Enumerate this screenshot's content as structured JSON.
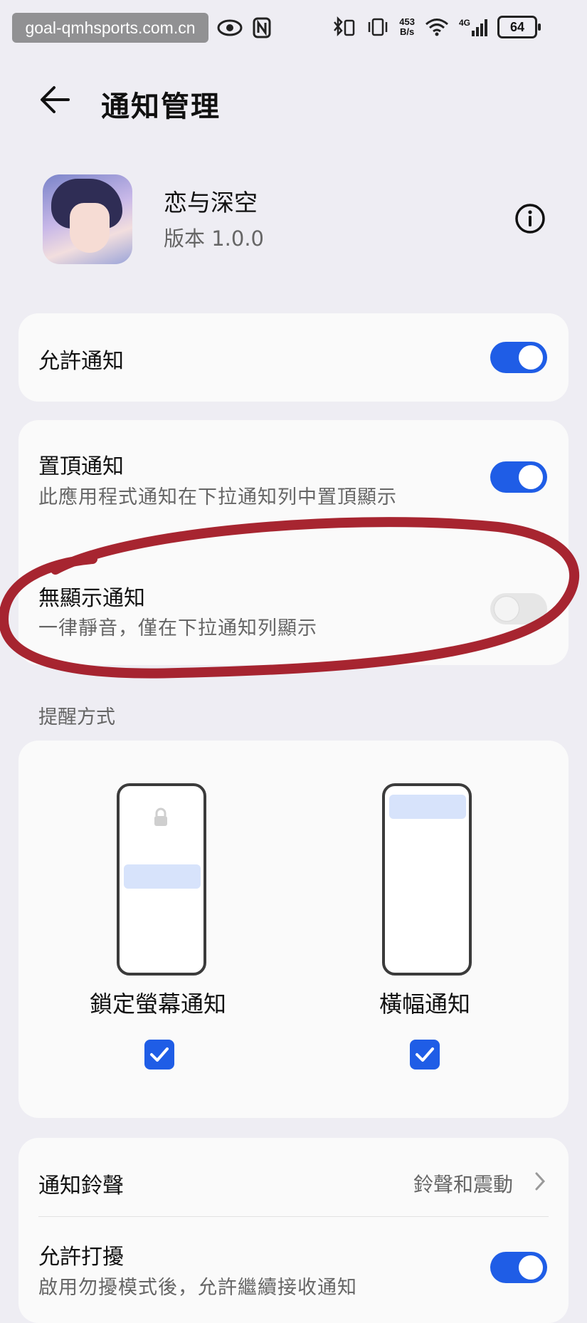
{
  "status_bar": {
    "watermark": "goal-qmhsports.com.cn",
    "speed": "453\nB/s",
    "network": "4G",
    "battery": "64"
  },
  "header": {
    "title": "通知管理"
  },
  "app": {
    "name": "恋与深空",
    "version": "版本 1.0.0"
  },
  "settings": {
    "allow_notifications": {
      "title": "允許通知",
      "enabled": true
    },
    "pin_notifications": {
      "title": "置頂通知",
      "subtitle": "此應用程式通知在下拉通知列中置頂顯示",
      "enabled": true
    },
    "silent_notifications": {
      "title": "無顯示通知",
      "subtitle": "一律靜音，僅在下拉通知列顯示",
      "enabled": false
    }
  },
  "reminder": {
    "section_label": "提醒方式",
    "modes": [
      {
        "label": "鎖定螢幕通知",
        "checked": true
      },
      {
        "label": "橫幅通知",
        "checked": true
      }
    ]
  },
  "sound": {
    "ringtone_title": "通知鈴聲",
    "ringtone_value": "鈴聲和震動",
    "dnd_title": "允許打擾",
    "dnd_subtitle": "啟用勿擾模式後，允許繼續接收通知",
    "dnd_enabled": true
  },
  "colors": {
    "accent": "#1f5de6",
    "background": "#eeedf3",
    "card": "#fafafa",
    "annotation": "#a01420"
  }
}
